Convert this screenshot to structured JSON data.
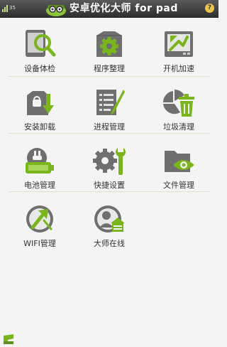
{
  "titlebar": {
    "title": "安卓优化大师 for pad",
    "signal_text": "35",
    "help_label": "?"
  },
  "tiles": [
    {
      "label": "设备体检",
      "icon": "device-check-icon"
    },
    {
      "label": "程序整理",
      "icon": "gear-box-icon"
    },
    {
      "label": "开机加速",
      "icon": "boot-accelerate-icon"
    },
    {
      "label": "安装卸载",
      "icon": "install-uninstall-icon"
    },
    {
      "label": "进程管理",
      "icon": "process-manage-icon"
    },
    {
      "label": "垃圾清理",
      "icon": "trash-clean-icon"
    },
    {
      "label": "电池管理",
      "icon": "battery-icon"
    },
    {
      "label": "快捷设置",
      "icon": "quick-settings-icon"
    },
    {
      "label": "文件管理",
      "icon": "file-manage-icon"
    },
    {
      "label": "WIFI管理",
      "icon": "wifi-manage-icon"
    },
    {
      "label": "大师在线",
      "icon": "master-online-icon"
    }
  ],
  "colors": {
    "accent_green": "#7ab51d",
    "icon_gray": "#6f6f6f",
    "titlebar": "#3a3a3a"
  }
}
